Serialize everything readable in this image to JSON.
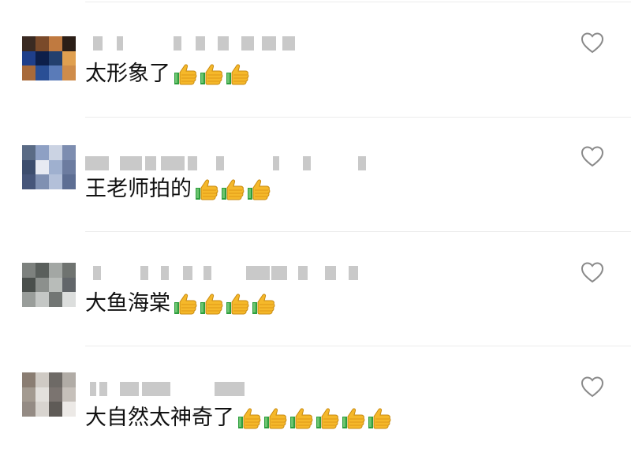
{
  "comments": [
    {
      "text": "太形象了",
      "thumbs_count": 3,
      "avatar_colors": [
        "#3a2a22",
        "#7a4a2a",
        "#c07a40",
        "#2b1e17",
        "#1f3f8a",
        "#0d1f4a",
        "#23406e",
        "#e0a050",
        "#a86a3a",
        "#2a4f95",
        "#5a7bb8",
        "#cf8c4a"
      ]
    },
    {
      "text": "王老师拍的",
      "thumbs_count": 3,
      "avatar_colors": [
        "#5a6b85",
        "#8ea0c4",
        "#cbd3e3",
        "#7d8db0",
        "#3d4e6e",
        "#e7eaf2",
        "#9fb0cf",
        "#6c7ca0",
        "#46567a",
        "#7f90b2",
        "#b3c0d9",
        "#5d6e93"
      ]
    },
    {
      "text": "大鱼海棠",
      "thumbs_count": 4,
      "avatar_colors": [
        "#7d817e",
        "#5a5f5c",
        "#a3a7a4",
        "#6f7370",
        "#4a4f4c",
        "#8c908d",
        "#b8bcb9",
        "#62666a",
        "#999d9a",
        "#c4c7c5",
        "#727674",
        "#dcdedd"
      ]
    },
    {
      "text": "大自然太神奇了",
      "thumbs_count": 6,
      "avatar_colors": [
        "#8a7d72",
        "#cfcac4",
        "#6e6a66",
        "#b1aca6",
        "#a39a90",
        "#e3e0dc",
        "#7b7470",
        "#c6c0ba",
        "#948b84",
        "#d8d4cf",
        "#5f5b57",
        "#ece9e6"
      ]
    }
  ],
  "icons": {
    "like": "heart-outline-icon",
    "thumb": "thumbs-up-emoji-icon"
  },
  "colors": {
    "text": "#111111",
    "heart_stroke": "#8a8a8a",
    "thumb_yellow": "#f5b82a",
    "thumb_green": "#2e9e3e"
  }
}
